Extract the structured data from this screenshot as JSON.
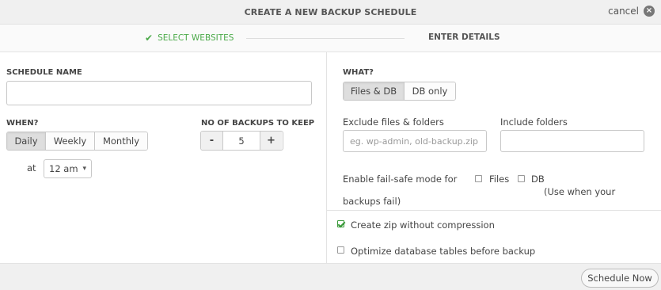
{
  "header": {
    "title": "CREATE A NEW BACKUP SCHEDULE",
    "cancel_label": "cancel",
    "close_icon": "×"
  },
  "steps": {
    "step1_icon": "✔",
    "step1_label": "SELECT WEBSITES",
    "step2_label": "ENTER DETAILS",
    "accent_color": "#4caa4a"
  },
  "schedule": {
    "name_label": "SCHEDULE NAME",
    "name_value": "",
    "when_label": "WHEN?",
    "frequency_options": [
      "Daily",
      "Weekly",
      "Monthly"
    ],
    "frequency_selected": "Daily",
    "at_label": "at",
    "time_value": "12 am",
    "chevron": "⌄",
    "backups_label": "NO OF BACKUPS TO KEEP",
    "minus": "-",
    "plus": "+",
    "backups_count": "5"
  },
  "what": {
    "label": "WHAT?",
    "options": [
      "Files & DB",
      "DB only"
    ],
    "selected": "Files & DB",
    "exclude_label": "Exclude files & folders",
    "exclude_placeholder": "eg. wp-admin, old-backup.zip",
    "include_label": "Include folders",
    "failsafe_label_1": "Enable fail-safe mode for",
    "failsafe_label_2": "backups fail)",
    "failsafe_files": "Files",
    "failsafe_db": "DB",
    "failsafe_note": "(Use when your",
    "zip_label": "Create zip without compression",
    "zip_checked": true,
    "optimize_label": "Optimize database tables before backup",
    "optimize_checked": false
  },
  "footer": {
    "schedule_button": "Schedule Now"
  }
}
